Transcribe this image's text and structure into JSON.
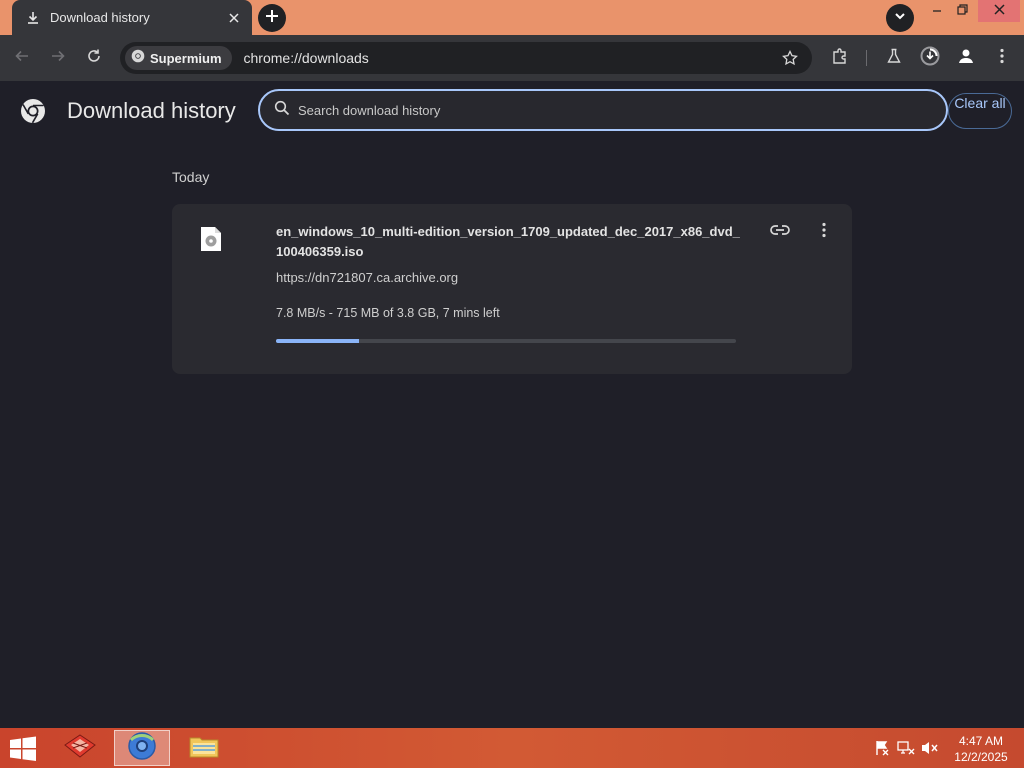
{
  "tab": {
    "title": "Download history"
  },
  "toolbar": {
    "site_chip": "Supermium",
    "url": "chrome://downloads"
  },
  "page": {
    "title": "Download history",
    "search_placeholder": "Search download history",
    "clear_all": "Clear all"
  },
  "downloads": {
    "group_label": "Today",
    "items": [
      {
        "file_name": "en_windows_10_multi-edition_version_1709_updated_dec_2017_x86_dvd_100406359.iso",
        "source": "https://dn721807.ca.archive.org",
        "status": "7.8 MB/s - 715 MB of 3.8 GB, 7 mins left",
        "progress": 0.18
      }
    ]
  },
  "taskbar": {
    "time": "4:47 AM",
    "date": "12/2/2025"
  },
  "colors": {
    "accent": "#a8c7fa",
    "progress": "#8ab4f8",
    "titlebar": "#e9936b",
    "taskbar": "#c9442c"
  },
  "icons": [
    "download-icon",
    "close-icon",
    "plus-icon",
    "chevron-down-icon",
    "minimize-icon",
    "restore-icon",
    "back-icon",
    "forward-icon",
    "reload-icon",
    "star-icon",
    "extensions-icon",
    "labs-icon",
    "downloads-icon",
    "profile-icon",
    "menu-icon",
    "chrome-logo-icon",
    "search-icon",
    "file-icon",
    "link-icon",
    "more-vert-icon",
    "windows-start-icon",
    "flag-icon",
    "network-icon",
    "speaker-muted-icon"
  ]
}
